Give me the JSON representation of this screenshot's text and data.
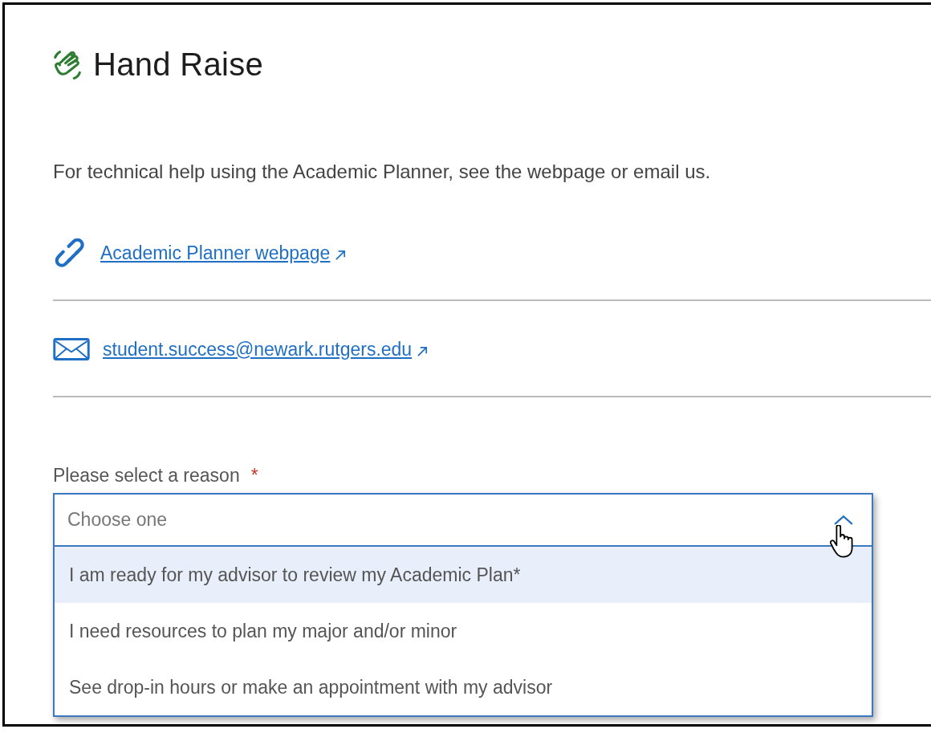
{
  "title": "Hand Raise",
  "intro": "For technical help using the Academic Planner, see the webpage or email us.",
  "links": [
    {
      "kind": "web",
      "text": "Academic Planner webpage",
      "external": true
    },
    {
      "kind": "email",
      "text": "student.success@newark.rutgers.edu",
      "external": true
    }
  ],
  "reason_select": {
    "label": "Please select a reason",
    "required_mark": "*",
    "placeholder": "Choose one",
    "expanded": true,
    "options": [
      {
        "text": "I am ready for my advisor to review my Academic Plan*",
        "selected": true
      },
      {
        "text": "I need resources to plan my major and/or minor",
        "selected": false
      },
      {
        "text": "See drop-in hours or make an appointment with my advisor",
        "selected": false
      }
    ]
  }
}
